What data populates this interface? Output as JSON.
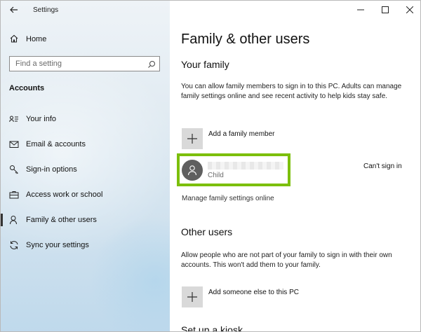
{
  "window": {
    "app_title": "Settings",
    "controls": [
      "minimize",
      "maximize",
      "close"
    ]
  },
  "sidebar": {
    "home_label": "Home",
    "search_placeholder": "Find a setting",
    "section_title": "Accounts",
    "items": [
      {
        "label": "Your info",
        "icon": "person-card-icon",
        "active": false
      },
      {
        "label": "Email & accounts",
        "icon": "mail-icon",
        "active": false
      },
      {
        "label": "Sign-in options",
        "icon": "key-icon",
        "active": false
      },
      {
        "label": "Access work or school",
        "icon": "briefcase-icon",
        "active": false
      },
      {
        "label": "Family & other users",
        "icon": "person-icon",
        "active": true
      },
      {
        "label": "Sync your settings",
        "icon": "sync-icon",
        "active": false
      }
    ]
  },
  "main": {
    "title": "Family & other users",
    "your_family": {
      "heading": "Your family",
      "description": "You can allow family members to sign in to this PC. Adults can manage family settings online and see recent activity to help kids stay safe.",
      "add_label": "Add a family member",
      "member": {
        "name": "",
        "role": "Child",
        "status": "Can't sign in"
      },
      "manage_link": "Manage family settings online"
    },
    "other_users": {
      "heading": "Other users",
      "description": "Allow people who are not part of your family to sign in with their own accounts. This won't add them to your family.",
      "add_label": "Add someone else to this PC"
    },
    "kiosk": {
      "heading": "Set up a kiosk"
    }
  },
  "colors": {
    "highlight_border": "#7cbf0c",
    "avatar_bg": "#5f5f5f",
    "plus_tile": "#d9d9d9"
  }
}
